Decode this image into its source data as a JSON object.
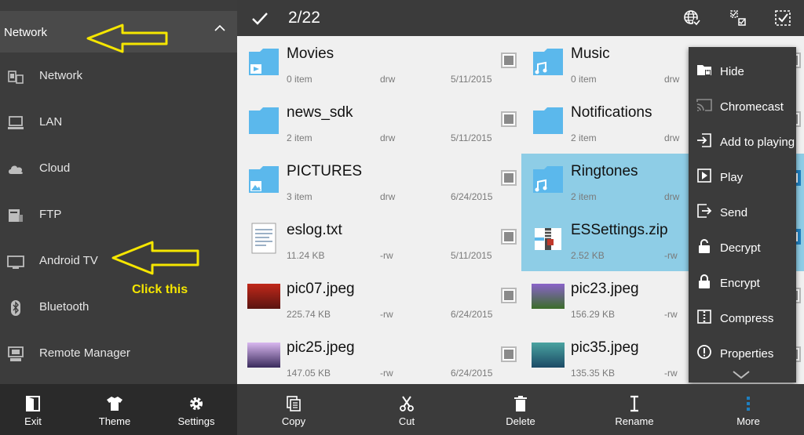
{
  "drawer": {
    "header_title": "Network",
    "items": [
      {
        "label": "Network"
      },
      {
        "label": "LAN"
      },
      {
        "label": "Cloud"
      },
      {
        "label": "FTP"
      },
      {
        "label": "Android TV"
      },
      {
        "label": "Bluetooth"
      },
      {
        "label": "Remote Manager"
      }
    ],
    "annotation": "Click this",
    "annotation_color": "#f5e600",
    "bottom": {
      "exit": "Exit",
      "theme": "Theme",
      "settings": "Settings"
    }
  },
  "topbar": {
    "selection_count": "2/22",
    "icons": [
      "check-icon",
      "globe-icon",
      "select-range-icon",
      "select-all-icon"
    ]
  },
  "files": [
    {
      "name": "Movies",
      "size": "0 item",
      "perm": "drw",
      "date": "5/11/2015",
      "selected": false,
      "icon": "folder-video-icon"
    },
    {
      "name": "Music",
      "size": "0 item",
      "perm": "drw",
      "date": "",
      "selected": false,
      "icon": "folder-music-icon"
    },
    {
      "name": "news_sdk",
      "size": "2 item",
      "perm": "drw",
      "date": "5/11/2015",
      "selected": false,
      "icon": "folder-icon"
    },
    {
      "name": "Notifications",
      "size": "2 item",
      "perm": "drw",
      "date": "",
      "selected": false,
      "icon": "folder-icon"
    },
    {
      "name": "PICTURES",
      "size": "3 item",
      "perm": "drw",
      "date": "6/24/2015",
      "selected": false,
      "icon": "folder-picture-icon"
    },
    {
      "name": "Ringtones",
      "size": "2 item",
      "perm": "drw",
      "date": "",
      "selected": true,
      "icon": "folder-music-icon"
    },
    {
      "name": "eslog.txt",
      "size": "11.24 KB",
      "perm": "-rw",
      "date": "5/11/2015",
      "selected": false,
      "icon": "text-file-icon"
    },
    {
      "name": "ESSettings.zip",
      "size": "2.52 KB",
      "perm": "-rw",
      "date": "",
      "selected": true,
      "icon": "zip-file-icon"
    },
    {
      "name": "pic07.jpeg",
      "size": "225.74 KB",
      "perm": "-rw",
      "date": "6/24/2015",
      "selected": false,
      "icon": "image-thumbnail"
    },
    {
      "name": "pic23.jpeg",
      "size": "156.29 KB",
      "perm": "-rw",
      "date": "",
      "selected": false,
      "icon": "image-thumbnail"
    },
    {
      "name": "pic25.jpeg",
      "size": "147.05 KB",
      "perm": "-rw",
      "date": "6/24/2015",
      "selected": false,
      "icon": "image-thumbnail"
    },
    {
      "name": "pic35.jpeg",
      "size": "135.35 KB",
      "perm": "-rw",
      "date": "",
      "selected": false,
      "icon": "image-thumbnail"
    }
  ],
  "menu": {
    "items": [
      {
        "label": "Hide",
        "icon": "hide-folder-icon"
      },
      {
        "label": "Chromecast",
        "icon": "cast-icon"
      },
      {
        "label": "Add to playing",
        "icon": "add-to-playlist-icon"
      },
      {
        "label": "Play",
        "icon": "play-icon"
      },
      {
        "label": "Send",
        "icon": "send-icon"
      },
      {
        "label": "Decrypt",
        "icon": "unlock-icon"
      },
      {
        "label": "Encrypt",
        "icon": "lock-icon"
      },
      {
        "label": "Compress",
        "icon": "compress-icon"
      },
      {
        "label": "Properties",
        "icon": "info-icon"
      }
    ]
  },
  "actions": {
    "copy": "Copy",
    "cut": "Cut",
    "delete": "Delete",
    "rename": "Rename",
    "more": "More"
  },
  "colors": {
    "accent_blue": "#1e7fc0",
    "selection": "#8ecde6",
    "folder": "#5bb8ec"
  }
}
